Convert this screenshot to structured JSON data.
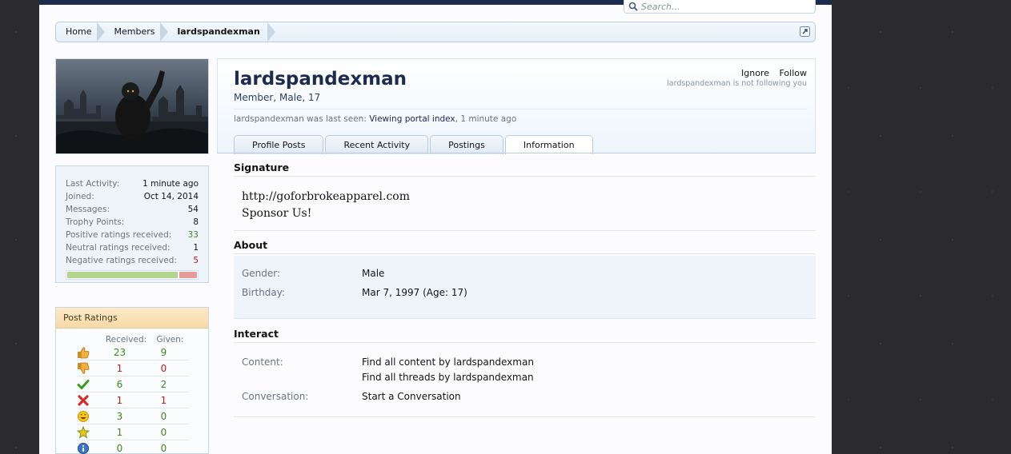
{
  "search": {
    "placeholder": "Search..."
  },
  "breadcrumb": {
    "items": [
      "Home",
      "Members",
      "lardspandexman"
    ]
  },
  "sidebar": {
    "stats": [
      {
        "label": "Last Activity:",
        "value": "1 minute ago",
        "tone": ""
      },
      {
        "label": "Joined:",
        "value": "Oct 14, 2014",
        "tone": ""
      },
      {
        "label": "Messages:",
        "value": "54",
        "tone": ""
      },
      {
        "label": "Trophy Points:",
        "value": "8",
        "tone": ""
      },
      {
        "label": "Positive ratings received:",
        "value": "33",
        "tone": "pos"
      },
      {
        "label": "Neutral ratings received:",
        "value": "1",
        "tone": ""
      },
      {
        "label": "Negative ratings received:",
        "value": "5",
        "tone": "neg"
      }
    ],
    "rating_bar_positive_fraction": 0.85,
    "post_ratings": {
      "title": "Post Ratings",
      "received_label": "Received:",
      "given_label": "Given:",
      "rows": [
        {
          "icon": "thumbs-up-icon",
          "received": "23",
          "given": "9"
        },
        {
          "icon": "thumbs-down-icon",
          "received": "1",
          "given": "0"
        },
        {
          "icon": "check-icon",
          "received": "6",
          "given": "2"
        },
        {
          "icon": "x-icon",
          "received": "1",
          "given": "1"
        },
        {
          "icon": "funny-face-icon",
          "received": "3",
          "given": "0"
        },
        {
          "icon": "star-icon",
          "received": "1",
          "given": "0"
        },
        {
          "icon": "info-icon",
          "received": "0",
          "given": "0"
        }
      ]
    }
  },
  "profile": {
    "username": "lardspandexman",
    "user_title": "Member, Male, 17",
    "ignore_label": "Ignore",
    "follow_label": "Follow",
    "follow_note": "lardspandexman is not following you",
    "last_seen_prefix": "lardspandexman was last seen:",
    "last_seen_link": "Viewing portal index",
    "last_seen_time": ", 1 minute ago"
  },
  "tabs": [
    {
      "label": "Profile Posts",
      "active": false
    },
    {
      "label": "Recent Activity",
      "active": false
    },
    {
      "label": "Postings",
      "active": false
    },
    {
      "label": "Information",
      "active": true
    }
  ],
  "signature": {
    "title": "Signature",
    "lines": [
      "http://goforbrokeapparel.com",
      "Sponsor Us!"
    ]
  },
  "about": {
    "title": "About",
    "gender_label": "Gender:",
    "gender_value": "Male",
    "birthday_label": "Birthday:",
    "birthday_value": "Mar 7, 1997 (Age: 17)"
  },
  "interact": {
    "title": "Interact",
    "content_label": "Content:",
    "content_link_1": "Find all content by lardspandexman",
    "content_link_2": "Find all threads by lardspandexman",
    "conversation_label": "Conversation:",
    "conversation_link": "Start a Conversation"
  },
  "colors": {
    "header_navy": "#1d2b4f",
    "positive": "#3a8a1a",
    "negative": "#c41a1a",
    "ratings_header": "#f7d9a8"
  }
}
